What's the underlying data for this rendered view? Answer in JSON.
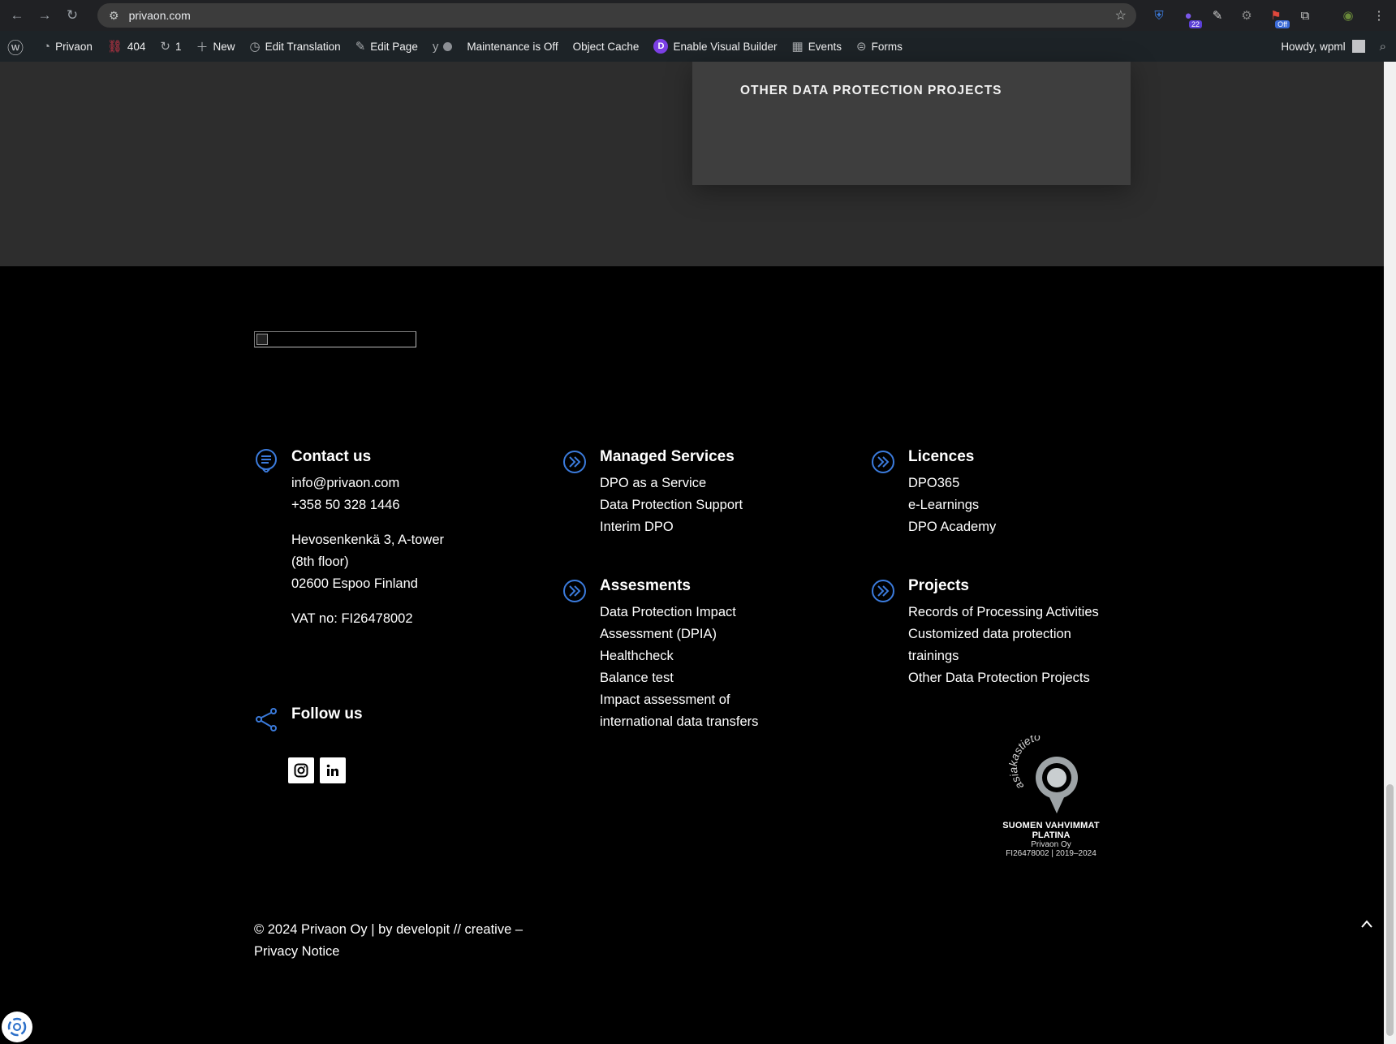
{
  "browser": {
    "url": "privaon.com",
    "extensions": {
      "badge_count": "22",
      "off_label": "Off"
    }
  },
  "wp_bar": {
    "site_name": "Privaon",
    "errors_404": "404",
    "updates_count": "1",
    "new_label": "New",
    "edit_translation": "Edit Translation",
    "edit_page": "Edit Page",
    "maintenance": "Maintenance is Off",
    "object_cache": "Object Cache",
    "visual_builder": "Enable Visual Builder",
    "events": "Events",
    "forms": "Forms",
    "greeting": "Howdy, wpml"
  },
  "project_card": {
    "title": "OTHER DATA PROTECTION PROJECTS"
  },
  "contact": {
    "title": "Contact us",
    "email": "info@privaon.com",
    "phone": "+358 50 328 1446",
    "address_line1": "Hevosenkenkä 3, A-tower",
    "address_line2": "(8th floor)",
    "address_line3": "02600 Espoo Finland",
    "vat": "VAT no: FI26478002"
  },
  "follow": {
    "title": "Follow us",
    "networks": [
      "instagram",
      "linkedin"
    ]
  },
  "managed_services": {
    "title": "Managed Services",
    "items": [
      "DPO as a Service",
      "Data Protection Support",
      "Interim DPO"
    ]
  },
  "assessments": {
    "title": "Assesments",
    "items": [
      "Data Protection Impact",
      "Assessment (DPIA)",
      "Healthcheck",
      "Balance test",
      "Impact assessment of",
      "international data transfers"
    ]
  },
  "licences": {
    "title": "Licences",
    "items": [
      "DPO365",
      "e-Learnings",
      "DPO Academy"
    ]
  },
  "projects": {
    "title": "Projects",
    "items": [
      "Records of Processing Activities",
      "Customized data protection",
      "trainings",
      "Other Data Protection Projects"
    ]
  },
  "certificate": {
    "brand": "asiakastieto",
    "line1": "SUOMEN VAHVIMMAT",
    "line2": "PLATINA",
    "line3": "Privaon Oy",
    "line4": "FI26478002  |  2019–2024"
  },
  "footer": {
    "copyright_line1": "© 2024 Privaon Oy | by developit // creative –",
    "copyright_line2": "Privacy Notice"
  },
  "colors": {
    "accent_blue": "#3b7bdc",
    "footer_bg": "#000000",
    "section_bg": "#2d2d2d",
    "card_bg": "#3e3e3e"
  }
}
